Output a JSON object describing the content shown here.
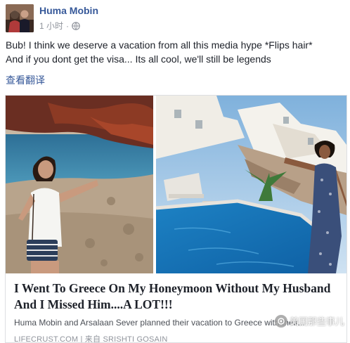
{
  "post": {
    "author": "Huma Mobin",
    "time": "1 小时",
    "privacy_icon": "globe-icon",
    "text_line1": "Bub! I think we deserve a vacation from all this media hype *Flips hair*",
    "text_line2": "And if you dont get the visa... Its all cool, we'll still be legends",
    "see_translation": "查看翻译"
  },
  "card": {
    "title": "I Went To Greece On My Honeymoon Without My Husband And I Missed Him....A LOT!!!",
    "description": "Huma Mobin and Arsalaan Sever planned their vacation to Greece with their...",
    "source": "LIFECRUST.COM | 来自 SRISHTI GOSAIN"
  },
  "watermark": {
    "text": "美国那些事儿"
  }
}
